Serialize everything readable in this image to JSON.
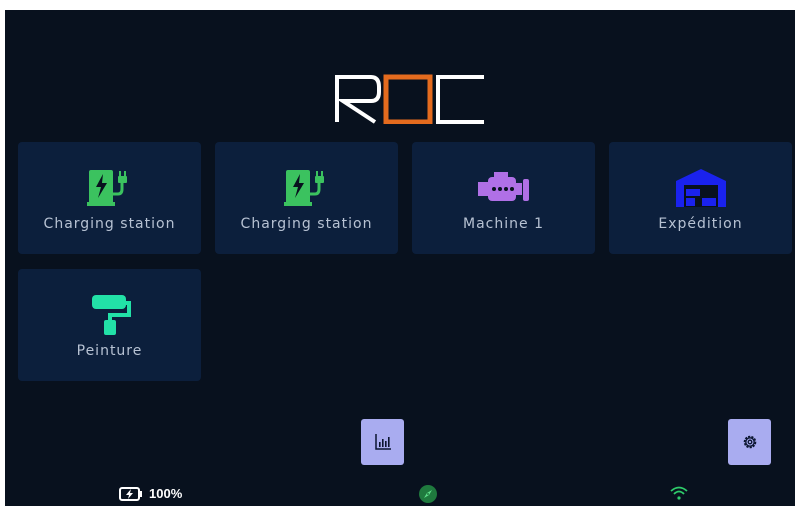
{
  "app": {
    "logo_text": "ROC"
  },
  "tiles": [
    {
      "label": "Charging station",
      "icon": "ev-charger-icon"
    },
    {
      "label": "Charging station",
      "icon": "ev-charger-icon"
    },
    {
      "label": "Machine 1",
      "icon": "engine-icon"
    },
    {
      "label": "Expédition",
      "icon": "warehouse-icon"
    },
    {
      "label": "Peinture",
      "icon": "paint-roller-icon"
    }
  ],
  "actions": {
    "stats_icon": "bar-chart-icon",
    "settings_icon": "gear-icon"
  },
  "status_bar": {
    "battery_level": "100%",
    "battery_icon": "battery-charging-icon",
    "compass_icon": "compass-icon",
    "wifi_icon": "wifi-icon"
  },
  "colors": {
    "background": "#08111e",
    "tile": "#0c1f3c",
    "logo_accent": "#e46b1e",
    "charger_green": "#3bc25f",
    "engine_purple": "#b070e6",
    "warehouse_blue": "#1a22ee",
    "roller_teal": "#22e1a7",
    "button": "#a9acf0",
    "wifi_green": "#2ecc6a"
  }
}
